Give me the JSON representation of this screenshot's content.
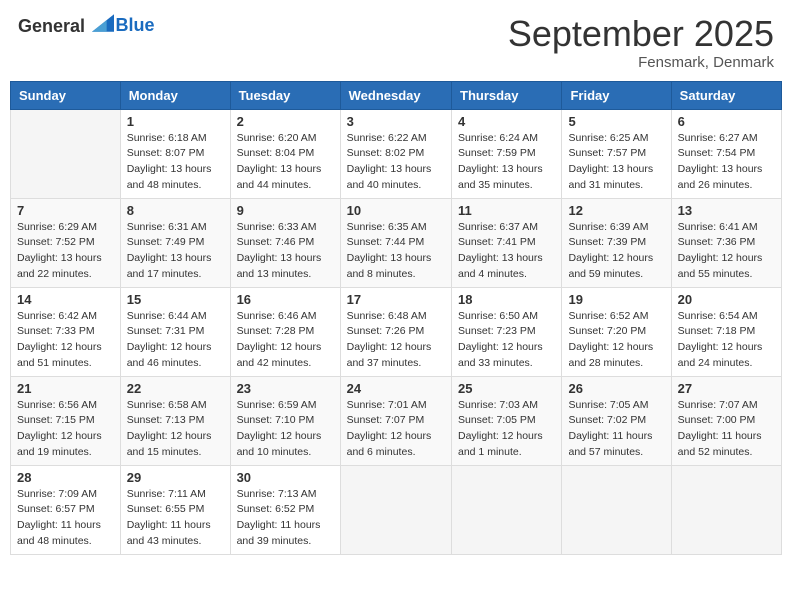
{
  "header": {
    "logo_general": "General",
    "logo_blue": "Blue",
    "month_title": "September 2025",
    "location": "Fensmark, Denmark"
  },
  "columns": [
    "Sunday",
    "Monday",
    "Tuesday",
    "Wednesday",
    "Thursday",
    "Friday",
    "Saturday"
  ],
  "weeks": [
    [
      {
        "day": "",
        "info": ""
      },
      {
        "day": "1",
        "info": "Sunrise: 6:18 AM\nSunset: 8:07 PM\nDaylight: 13 hours\nand 48 minutes."
      },
      {
        "day": "2",
        "info": "Sunrise: 6:20 AM\nSunset: 8:04 PM\nDaylight: 13 hours\nand 44 minutes."
      },
      {
        "day": "3",
        "info": "Sunrise: 6:22 AM\nSunset: 8:02 PM\nDaylight: 13 hours\nand 40 minutes."
      },
      {
        "day": "4",
        "info": "Sunrise: 6:24 AM\nSunset: 7:59 PM\nDaylight: 13 hours\nand 35 minutes."
      },
      {
        "day": "5",
        "info": "Sunrise: 6:25 AM\nSunset: 7:57 PM\nDaylight: 13 hours\nand 31 minutes."
      },
      {
        "day": "6",
        "info": "Sunrise: 6:27 AM\nSunset: 7:54 PM\nDaylight: 13 hours\nand 26 minutes."
      }
    ],
    [
      {
        "day": "7",
        "info": "Sunrise: 6:29 AM\nSunset: 7:52 PM\nDaylight: 13 hours\nand 22 minutes."
      },
      {
        "day": "8",
        "info": "Sunrise: 6:31 AM\nSunset: 7:49 PM\nDaylight: 13 hours\nand 17 minutes."
      },
      {
        "day": "9",
        "info": "Sunrise: 6:33 AM\nSunset: 7:46 PM\nDaylight: 13 hours\nand 13 minutes."
      },
      {
        "day": "10",
        "info": "Sunrise: 6:35 AM\nSunset: 7:44 PM\nDaylight: 13 hours\nand 8 minutes."
      },
      {
        "day": "11",
        "info": "Sunrise: 6:37 AM\nSunset: 7:41 PM\nDaylight: 13 hours\nand 4 minutes."
      },
      {
        "day": "12",
        "info": "Sunrise: 6:39 AM\nSunset: 7:39 PM\nDaylight: 12 hours\nand 59 minutes."
      },
      {
        "day": "13",
        "info": "Sunrise: 6:41 AM\nSunset: 7:36 PM\nDaylight: 12 hours\nand 55 minutes."
      }
    ],
    [
      {
        "day": "14",
        "info": "Sunrise: 6:42 AM\nSunset: 7:33 PM\nDaylight: 12 hours\nand 51 minutes."
      },
      {
        "day": "15",
        "info": "Sunrise: 6:44 AM\nSunset: 7:31 PM\nDaylight: 12 hours\nand 46 minutes."
      },
      {
        "day": "16",
        "info": "Sunrise: 6:46 AM\nSunset: 7:28 PM\nDaylight: 12 hours\nand 42 minutes."
      },
      {
        "day": "17",
        "info": "Sunrise: 6:48 AM\nSunset: 7:26 PM\nDaylight: 12 hours\nand 37 minutes."
      },
      {
        "day": "18",
        "info": "Sunrise: 6:50 AM\nSunset: 7:23 PM\nDaylight: 12 hours\nand 33 minutes."
      },
      {
        "day": "19",
        "info": "Sunrise: 6:52 AM\nSunset: 7:20 PM\nDaylight: 12 hours\nand 28 minutes."
      },
      {
        "day": "20",
        "info": "Sunrise: 6:54 AM\nSunset: 7:18 PM\nDaylight: 12 hours\nand 24 minutes."
      }
    ],
    [
      {
        "day": "21",
        "info": "Sunrise: 6:56 AM\nSunset: 7:15 PM\nDaylight: 12 hours\nand 19 minutes."
      },
      {
        "day": "22",
        "info": "Sunrise: 6:58 AM\nSunset: 7:13 PM\nDaylight: 12 hours\nand 15 minutes."
      },
      {
        "day": "23",
        "info": "Sunrise: 6:59 AM\nSunset: 7:10 PM\nDaylight: 12 hours\nand 10 minutes."
      },
      {
        "day": "24",
        "info": "Sunrise: 7:01 AM\nSunset: 7:07 PM\nDaylight: 12 hours\nand 6 minutes."
      },
      {
        "day": "25",
        "info": "Sunrise: 7:03 AM\nSunset: 7:05 PM\nDaylight: 12 hours\nand 1 minute."
      },
      {
        "day": "26",
        "info": "Sunrise: 7:05 AM\nSunset: 7:02 PM\nDaylight: 11 hours\nand 57 minutes."
      },
      {
        "day": "27",
        "info": "Sunrise: 7:07 AM\nSunset: 7:00 PM\nDaylight: 11 hours\nand 52 minutes."
      }
    ],
    [
      {
        "day": "28",
        "info": "Sunrise: 7:09 AM\nSunset: 6:57 PM\nDaylight: 11 hours\nand 48 minutes."
      },
      {
        "day": "29",
        "info": "Sunrise: 7:11 AM\nSunset: 6:55 PM\nDaylight: 11 hours\nand 43 minutes."
      },
      {
        "day": "30",
        "info": "Sunrise: 7:13 AM\nSunset: 6:52 PM\nDaylight: 11 hours\nand 39 minutes."
      },
      {
        "day": "",
        "info": ""
      },
      {
        "day": "",
        "info": ""
      },
      {
        "day": "",
        "info": ""
      },
      {
        "day": "",
        "info": ""
      }
    ]
  ]
}
